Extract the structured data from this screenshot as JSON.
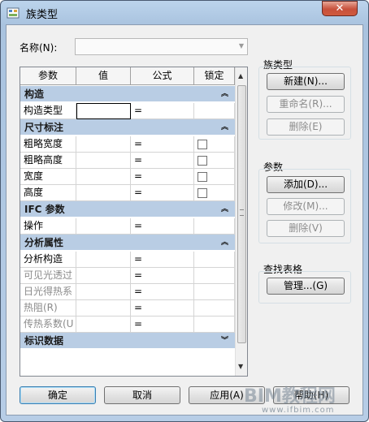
{
  "window": {
    "title": "族类型",
    "close_label": "✕"
  },
  "name_field": {
    "label": "名称(N):",
    "value": ""
  },
  "grid": {
    "headers": [
      "参数",
      "值",
      "公式",
      "锁定"
    ],
    "rows": [
      {
        "kind": "category",
        "label": "构造",
        "chevron": "︽"
      },
      {
        "kind": "param",
        "name": "构造类型",
        "value": "",
        "formula": "=",
        "lock": false,
        "greyed": false,
        "selected": true
      },
      {
        "kind": "category",
        "label": "尺寸标注",
        "chevron": "︽"
      },
      {
        "kind": "param",
        "name": "粗略宽度",
        "value": "",
        "formula": "=",
        "lock": true,
        "greyed": false
      },
      {
        "kind": "param",
        "name": "粗略高度",
        "value": "",
        "formula": "=",
        "lock": true,
        "greyed": false
      },
      {
        "kind": "param",
        "name": "宽度",
        "value": "",
        "formula": "=",
        "lock": true,
        "greyed": false
      },
      {
        "kind": "param",
        "name": "高度",
        "value": "",
        "formula": "=",
        "lock": true,
        "greyed": false
      },
      {
        "kind": "category",
        "label": "IFC 参数",
        "chevron": "︽"
      },
      {
        "kind": "param",
        "name": "操作",
        "value": "",
        "formula": "=",
        "lock": false,
        "greyed": false
      },
      {
        "kind": "category",
        "label": "分析属性",
        "chevron": "︽"
      },
      {
        "kind": "param",
        "name": "分析构造",
        "value": "",
        "formula": "=",
        "lock": false,
        "greyed": false
      },
      {
        "kind": "param",
        "name": "可见光透过",
        "value": "",
        "formula": "=",
        "lock": false,
        "greyed": true
      },
      {
        "kind": "param",
        "name": "日光得热系",
        "value": "",
        "formula": "=",
        "lock": false,
        "greyed": true
      },
      {
        "kind": "param",
        "name": "热阻(R)",
        "value": "",
        "formula": "=",
        "lock": false,
        "greyed": true
      },
      {
        "kind": "param",
        "name": "传热系数(U",
        "value": "",
        "formula": "=",
        "lock": false,
        "greyed": true
      },
      {
        "kind": "category",
        "label": "标识数据",
        "chevron": "︾"
      }
    ]
  },
  "family_types": {
    "title": "族类型",
    "new_label": "新建(N)...",
    "rename_label": "重命名(R)...",
    "delete_label": "删除(E)"
  },
  "parameters": {
    "title": "参数",
    "add_label": "添加(D)...",
    "modify_label": "修改(M)...",
    "delete_label": "删除(V)"
  },
  "lookup_tables": {
    "title": "查找表格",
    "manage_label": "管理...(G)"
  },
  "footer": {
    "ok_label": "确定",
    "cancel_label": "取消",
    "apply_label": "应用(A)",
    "help_label": "帮助(H)"
  },
  "watermark": {
    "text": "BIM教程网",
    "url": "www.ifbim.com"
  },
  "colors": {
    "category_bg": "#b9cde4",
    "frame": "#a9c3df",
    "close": "#c7503b"
  }
}
